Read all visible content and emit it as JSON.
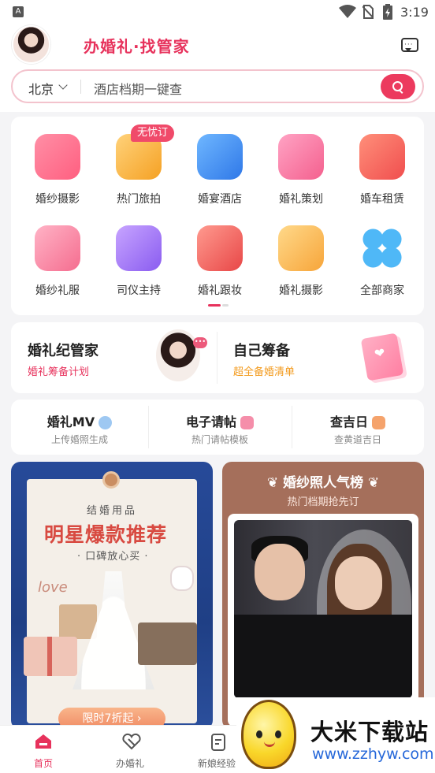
{
  "status": {
    "badge": "A",
    "time": "3:19"
  },
  "header": {
    "brand": "办婚礼·找管家"
  },
  "search": {
    "city": "北京",
    "placeholder": "酒店档期一键查"
  },
  "categories": [
    {
      "label": "婚纱摄影",
      "icon": "camera-icon"
    },
    {
      "label": "热门旅拍",
      "icon": "hot-air-balloon-icon"
    },
    {
      "label": "婚宴酒店",
      "icon": "hotel-building-icon"
    },
    {
      "label": "婚礼策划",
      "icon": "wedding-arch-icon"
    },
    {
      "label": "婚车租赁",
      "icon": "car-icon"
    },
    {
      "label": "婚纱礼服",
      "icon": "dress-icon"
    },
    {
      "label": "司仪主持",
      "icon": "microphone-icon"
    },
    {
      "label": "婚礼跟妆",
      "icon": "lipstick-icon"
    },
    {
      "label": "婚礼摄影",
      "icon": "picture-icon"
    },
    {
      "label": "全部商家",
      "icon": "clover-grid-icon"
    }
  ],
  "badge_label": "无忧订",
  "butler": {
    "title": "婚礼纪管家",
    "sub": "婚礼筹备计划",
    "bubble": "•••",
    "diy_title": "自己筹备",
    "diy_sub": "超全备婚清单"
  },
  "tools": [
    {
      "title": "婚礼MV",
      "sub": "上传婚照生成"
    },
    {
      "title": "电子请帖",
      "sub": "热门请帖模板"
    },
    {
      "title": "查吉日",
      "sub": "查黄道吉日"
    }
  ],
  "banner1": {
    "top": "结婚用品",
    "title": "明星爆款推荐",
    "sub": "· 口碑放心买 ·",
    "love": "love",
    "pill": "限时7折起 ›"
  },
  "banner2": {
    "title": "❦ 婚纱照人气榜 ❦",
    "sub": "热门档期抢先订"
  },
  "nav": [
    {
      "label": "首页",
      "icon": "home-icon"
    },
    {
      "label": "办婚礼",
      "icon": "rings-icon"
    },
    {
      "label": "新娘经验",
      "icon": "document-icon"
    }
  ],
  "watermark": {
    "title": "大米下载站",
    "url": "www.zzhyw.com"
  },
  "colors": {
    "accent": "#e7325c",
    "orange": "#f39a1c"
  }
}
